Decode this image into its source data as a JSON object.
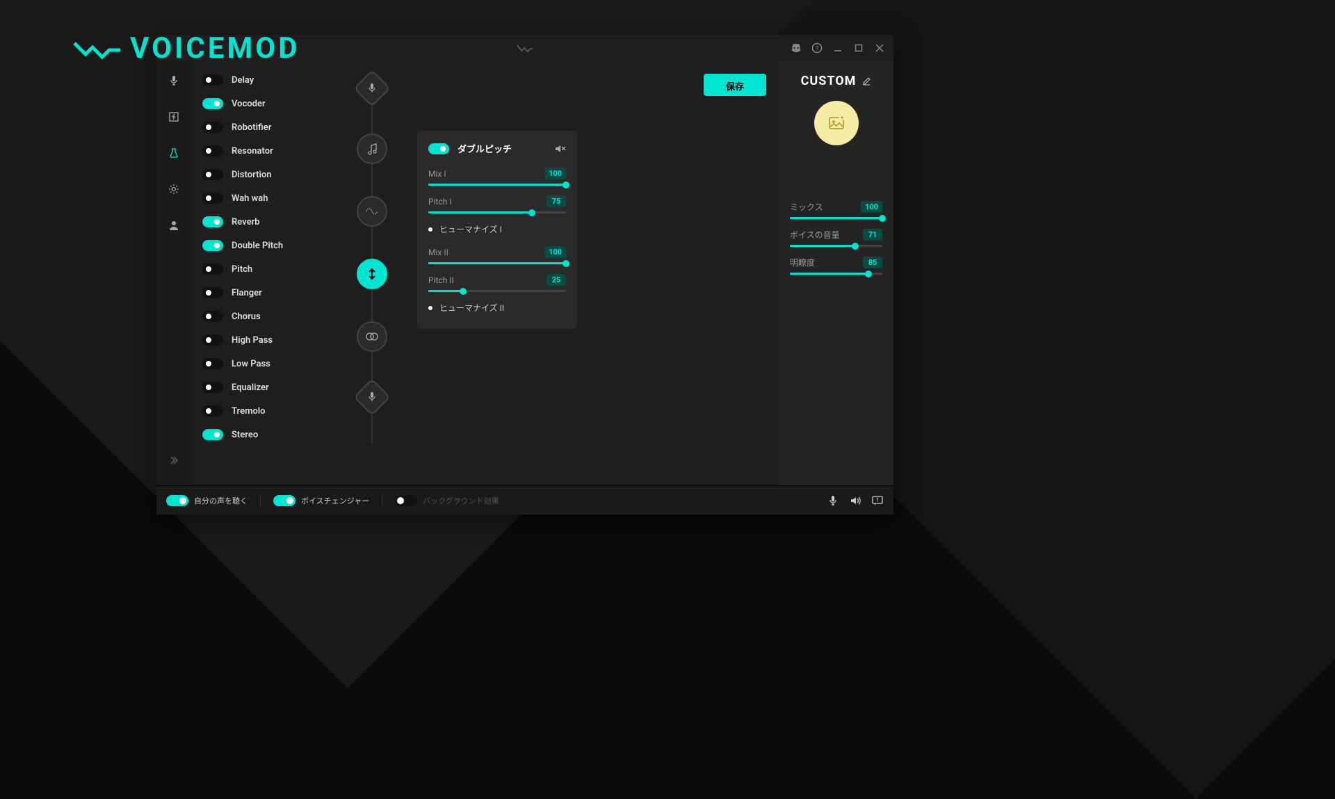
{
  "brand": "VOICEMOD",
  "titlebar": {
    "discord_icon": "discord",
    "help_icon": "help",
    "minimize_icon": "minimize",
    "maximize_icon": "maximize",
    "close_icon": "close"
  },
  "save_button": "保存",
  "effects": [
    {
      "label": "Delay",
      "on": false
    },
    {
      "label": "Vocoder",
      "on": true
    },
    {
      "label": "Robotifier",
      "on": false
    },
    {
      "label": "Resonator",
      "on": false
    },
    {
      "label": "Distortion",
      "on": false
    },
    {
      "label": "Wah wah",
      "on": false
    },
    {
      "label": "Reverb",
      "on": true
    },
    {
      "label": "Double Pitch",
      "on": true
    },
    {
      "label": "Pitch",
      "on": false
    },
    {
      "label": "Flanger",
      "on": false
    },
    {
      "label": "Chorus",
      "on": false
    },
    {
      "label": "High Pass",
      "on": false
    },
    {
      "label": "Low Pass",
      "on": false
    },
    {
      "label": "Equalizer",
      "on": false
    },
    {
      "label": "Tremolo",
      "on": false
    },
    {
      "label": "Stereo",
      "on": true
    }
  ],
  "detail": {
    "on": true,
    "title": "ダブルピッチ",
    "sliders": {
      "mix1": {
        "label": "Mix I",
        "value": 100
      },
      "pitch1": {
        "label": "Pitch I",
        "value": 75
      },
      "mix2": {
        "label": "Mix II",
        "value": 100
      },
      "pitch2": {
        "label": "Pitch II",
        "value": 25
      }
    },
    "humanize1": "ヒューマナイズ I",
    "humanize2": "ヒューマナイズ II"
  },
  "right": {
    "title": "CUSTOM",
    "sliders": {
      "mix": {
        "label": "ミックス",
        "value": 100
      },
      "volume": {
        "label": "ボイスの音量",
        "value": 71
      },
      "clarity": {
        "label": "明瞭度",
        "value": 85
      }
    }
  },
  "bottom": {
    "hear": {
      "label": "自分の声を聴く",
      "on": true
    },
    "changer": {
      "label": "ボイスチェンジャー",
      "on": true
    },
    "bg": {
      "label": "バックグラウンド効果",
      "on": false
    }
  }
}
